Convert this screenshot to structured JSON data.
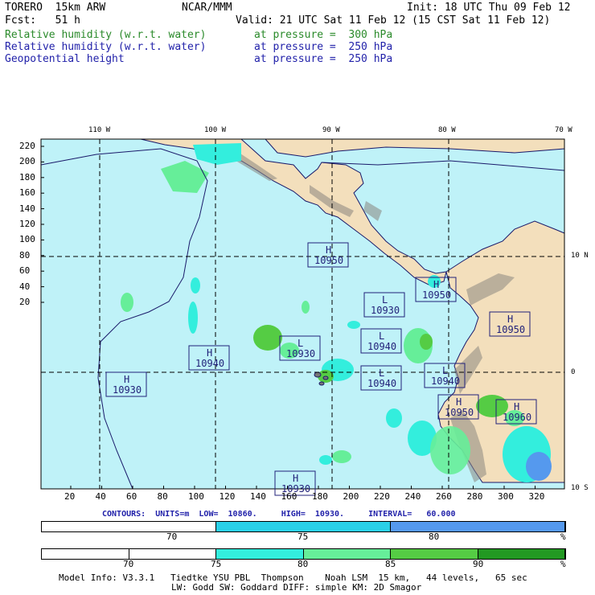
{
  "header": {
    "model": "TORERO  15km ARW",
    "org": "NCAR/MMM",
    "init": "Init: 18 UTC Thu 09 Feb 12",
    "fcst": "Fcst:   51 h",
    "valid": "Valid: 21 UTC Sat 11 Feb 12 (15 CST Sat 11 Feb 12)"
  },
  "fields": [
    {
      "name": "Relative humidity (w.r.t. water)",
      "level": "at pressure =  300 hPa",
      "color": "#2a8a2a"
    },
    {
      "name": "Relative humidity (w.r.t. water)",
      "level": "at pressure =  250 hPa",
      "color": "#2222aa"
    },
    {
      "name": "Geopotential height",
      "level": "at pressure =  250 hPa",
      "color": "#2222aa"
    }
  ],
  "lon_labels": [
    "110 W",
    "100 W",
    "90 W",
    "80 W",
    "70 W"
  ],
  "lat_labels": [
    "10 N",
    "0",
    "10 S"
  ],
  "y_ticks": [
    "220",
    "200",
    "180",
    "160",
    "140",
    "120",
    "100",
    "80",
    "60",
    "40",
    "20"
  ],
  "x_ticks": [
    "20",
    "40",
    "60",
    "80",
    "100",
    "120",
    "140",
    "160",
    "180",
    "200",
    "220",
    "240",
    "260",
    "280",
    "300",
    "320"
  ],
  "highs_lows": [
    {
      "type": "H",
      "value": "10950"
    },
    {
      "type": "H",
      "value": "10950"
    },
    {
      "type": "L",
      "value": "10930"
    },
    {
      "type": "H",
      "value": "10950"
    },
    {
      "type": "L",
      "value": "10930"
    },
    {
      "type": "L",
      "value": "10940"
    },
    {
      "type": "H",
      "value": "10940"
    },
    {
      "type": "L",
      "value": "10940"
    },
    {
      "type": "L",
      "value": "10940"
    },
    {
      "type": "H",
      "value": "10930"
    },
    {
      "type": "H",
      "value": "10950"
    },
    {
      "type": "H",
      "value": "10960"
    },
    {
      "type": "H",
      "value": "10930"
    }
  ],
  "contour_info": "CONTOURS:  UNITS=m  LOW=  10860.     HIGH=  10930.     INTERVAL=   60.000",
  "colorbar1": {
    "labels": [
      "70",
      "75",
      "80"
    ],
    "unit": "%",
    "colors": [
      "#ffffff",
      "#2ad0e8",
      "#5599ee"
    ]
  },
  "colorbar2": {
    "labels": [
      "70",
      "75",
      "80",
      "85",
      "90"
    ],
    "unit": "%",
    "colors": [
      "#ffffff",
      "#ffffff",
      "#33eedd",
      "#66ee99",
      "#55cc44",
      "#229922"
    ]
  },
  "model_info_1": "Model Info: V3.3.1   Tiedtke YSU PBL  Thompson    Noah LSM  15 km,   44 levels,   65 sec",
  "model_info_2": "LW: Godd SW: Goddard DIFF: simple KM: 2D Smagor"
}
